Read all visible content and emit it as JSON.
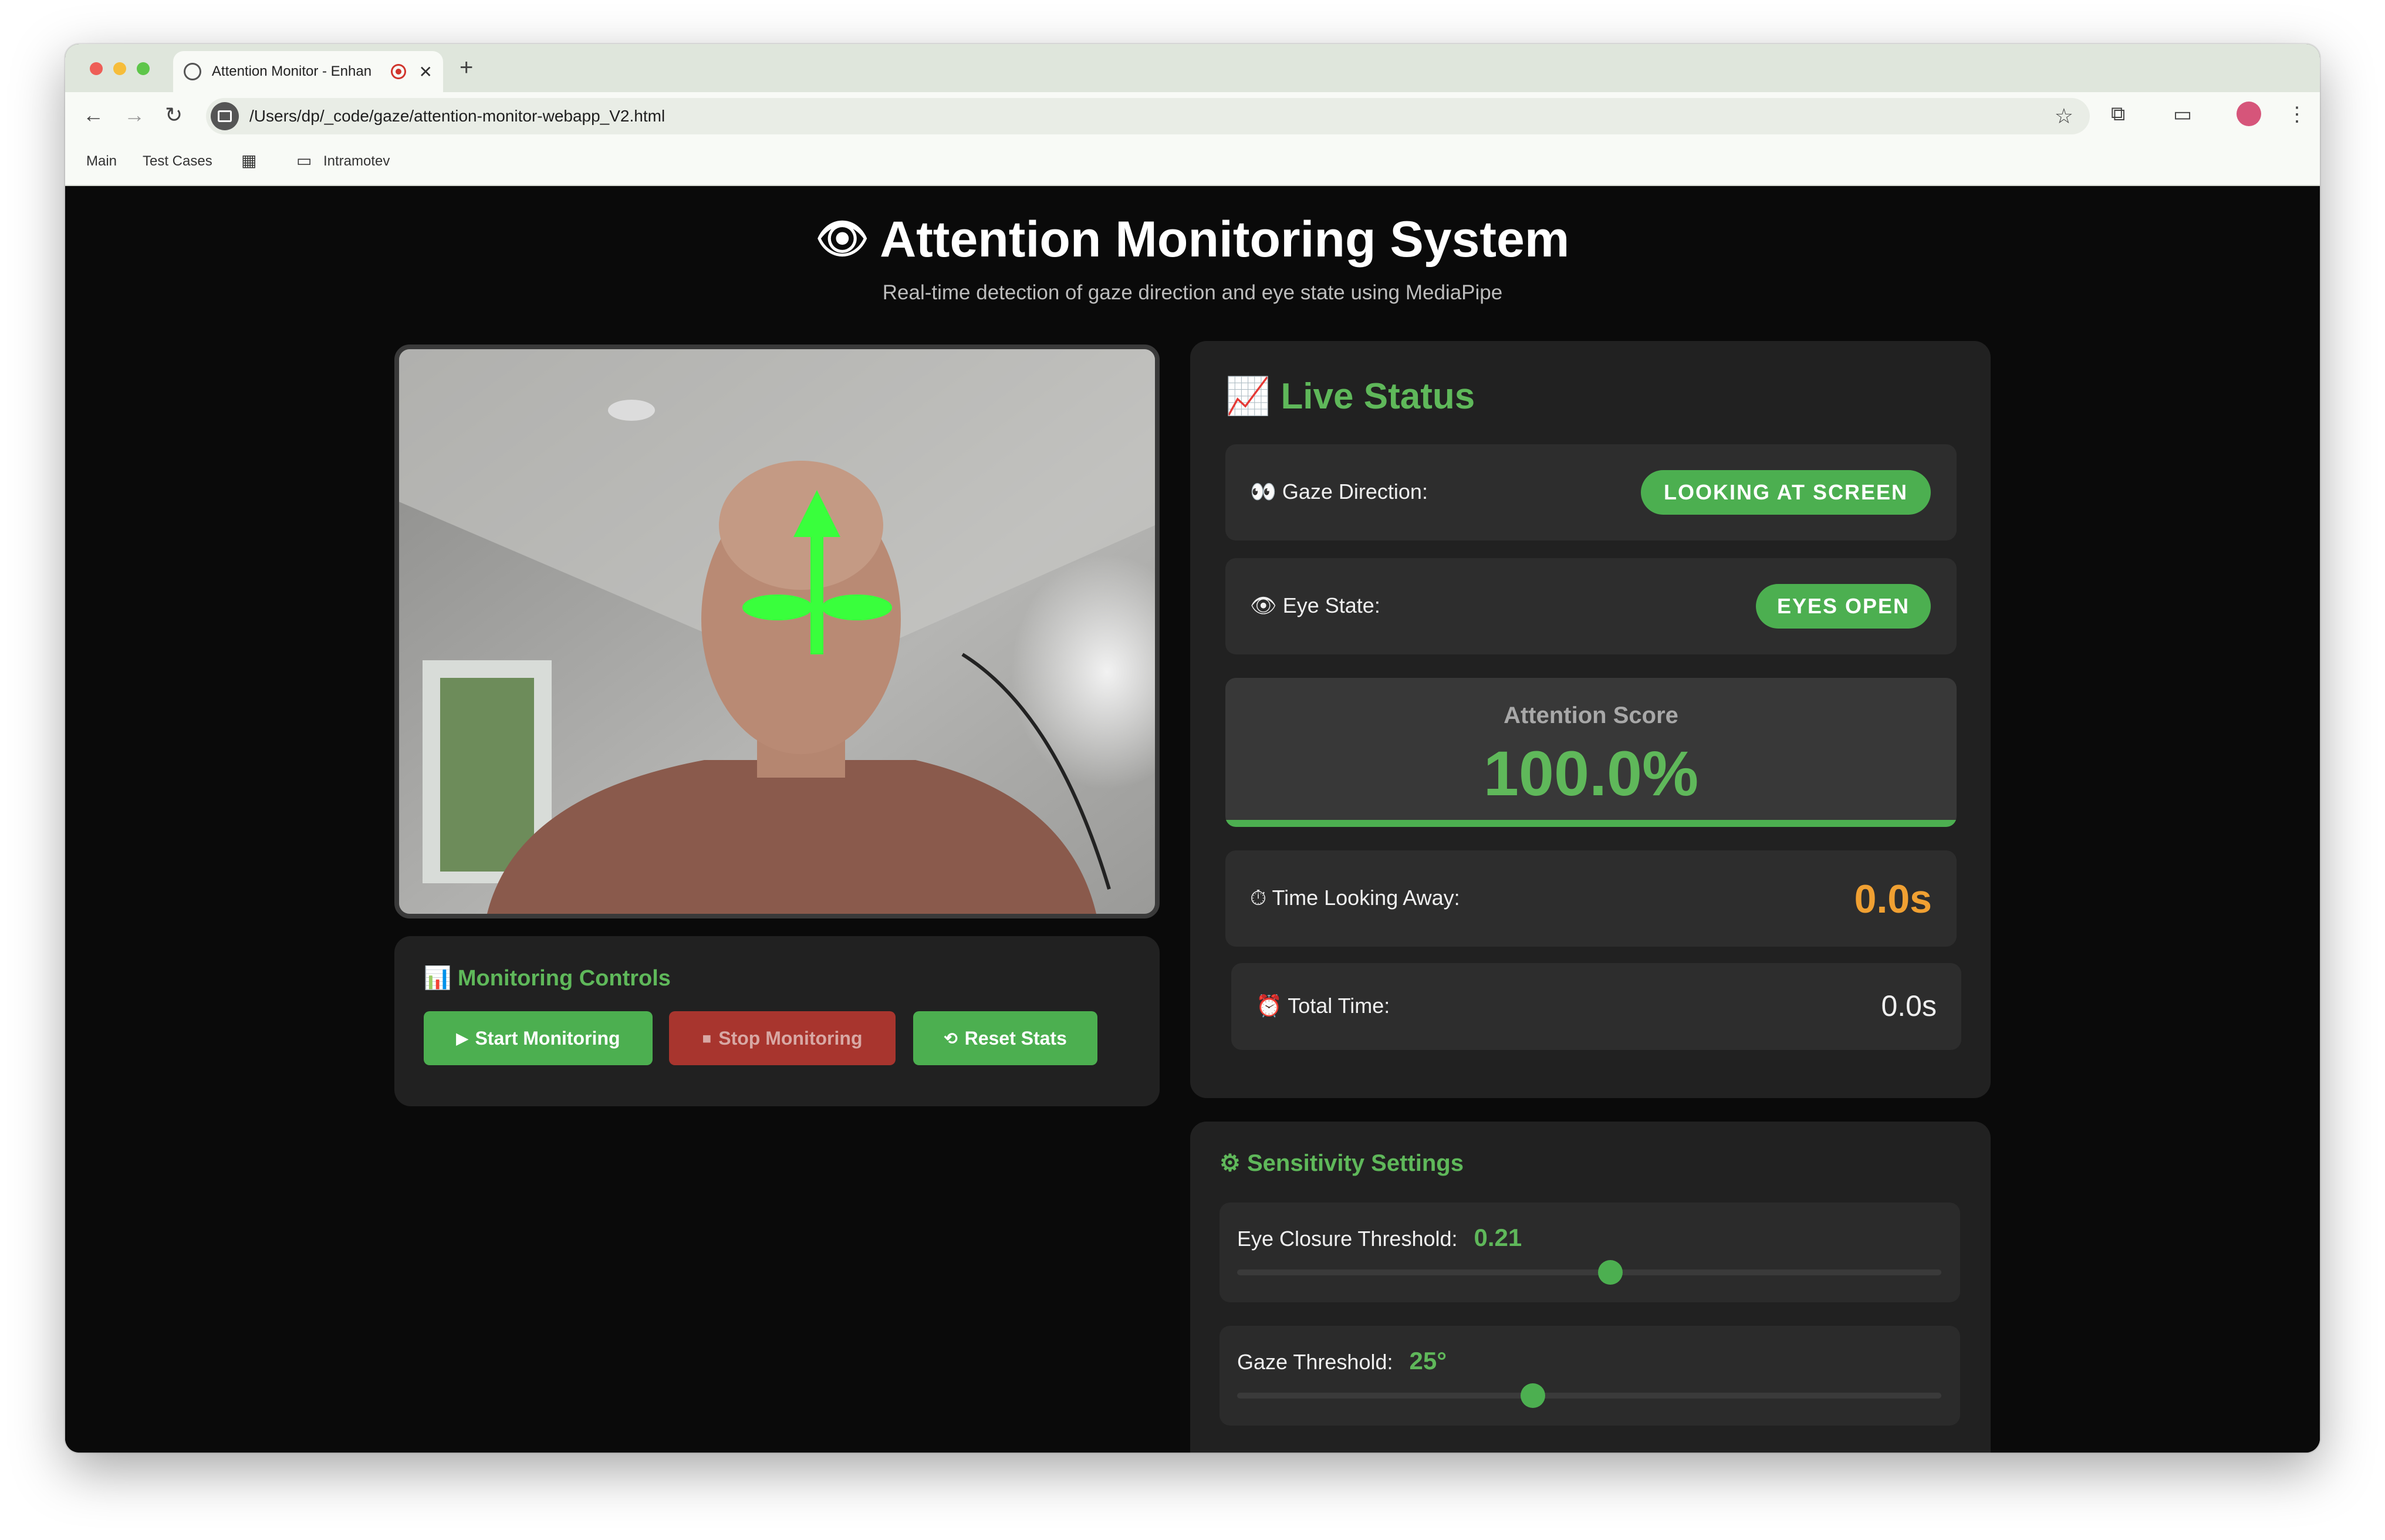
{
  "browser": {
    "tab_title": "Attention Monitor - Enhan",
    "url": "/Users/dp/_code/gaze/attention-monitor-webapp_V2.html",
    "bookmarks": [
      "Main",
      "Test Cases",
      "Intramotev"
    ]
  },
  "page": {
    "title": "Attention Monitoring System",
    "subtitle": "Real-time detection of gaze direction and eye state using MediaPipe"
  },
  "controls": {
    "title": "Monitoring Controls",
    "start_label": "Start Monitoring",
    "stop_label": "Stop Monitoring",
    "reset_label": "Reset Stats"
  },
  "live_status": {
    "title": "Live Status",
    "gaze_label": "Gaze Direction:",
    "gaze_value": "LOOKING AT SCREEN",
    "eye_label": "Eye State:",
    "eye_value": "EYES OPEN",
    "score_label": "Attention Score",
    "score_value": "100.0%",
    "score_fraction": 1.0,
    "away_label": "Time Looking Away:",
    "away_value": "0.0s",
    "total_label": "Total Time:",
    "total_value": "0.0s"
  },
  "sensitivity": {
    "title": "Sensitivity Settings",
    "eye_threshold_label": "Eye Closure Threshold:",
    "eye_threshold_value": "0.21",
    "eye_threshold_level": 0.53,
    "gaze_threshold_label": "Gaze Threshold:",
    "gaze_threshold_value": "25°",
    "gaze_threshold_level": 0.42
  },
  "colors": {
    "accent": "#5fb85a",
    "accent_fill": "#4caf50",
    "stop": "#a8352e",
    "warning": "#f0a032",
    "background": "#0a0a0a",
    "panel": "#212121"
  },
  "icons": {
    "title": "eye-icon",
    "live_status": "chart-increasing-icon",
    "controls": "bar-chart-icon",
    "gaze": "eyes-icon",
    "eye_state": "eye-icon",
    "away": "stopwatch-icon",
    "total": "alarm-clock-icon",
    "sensitivity": "gear-icon"
  }
}
